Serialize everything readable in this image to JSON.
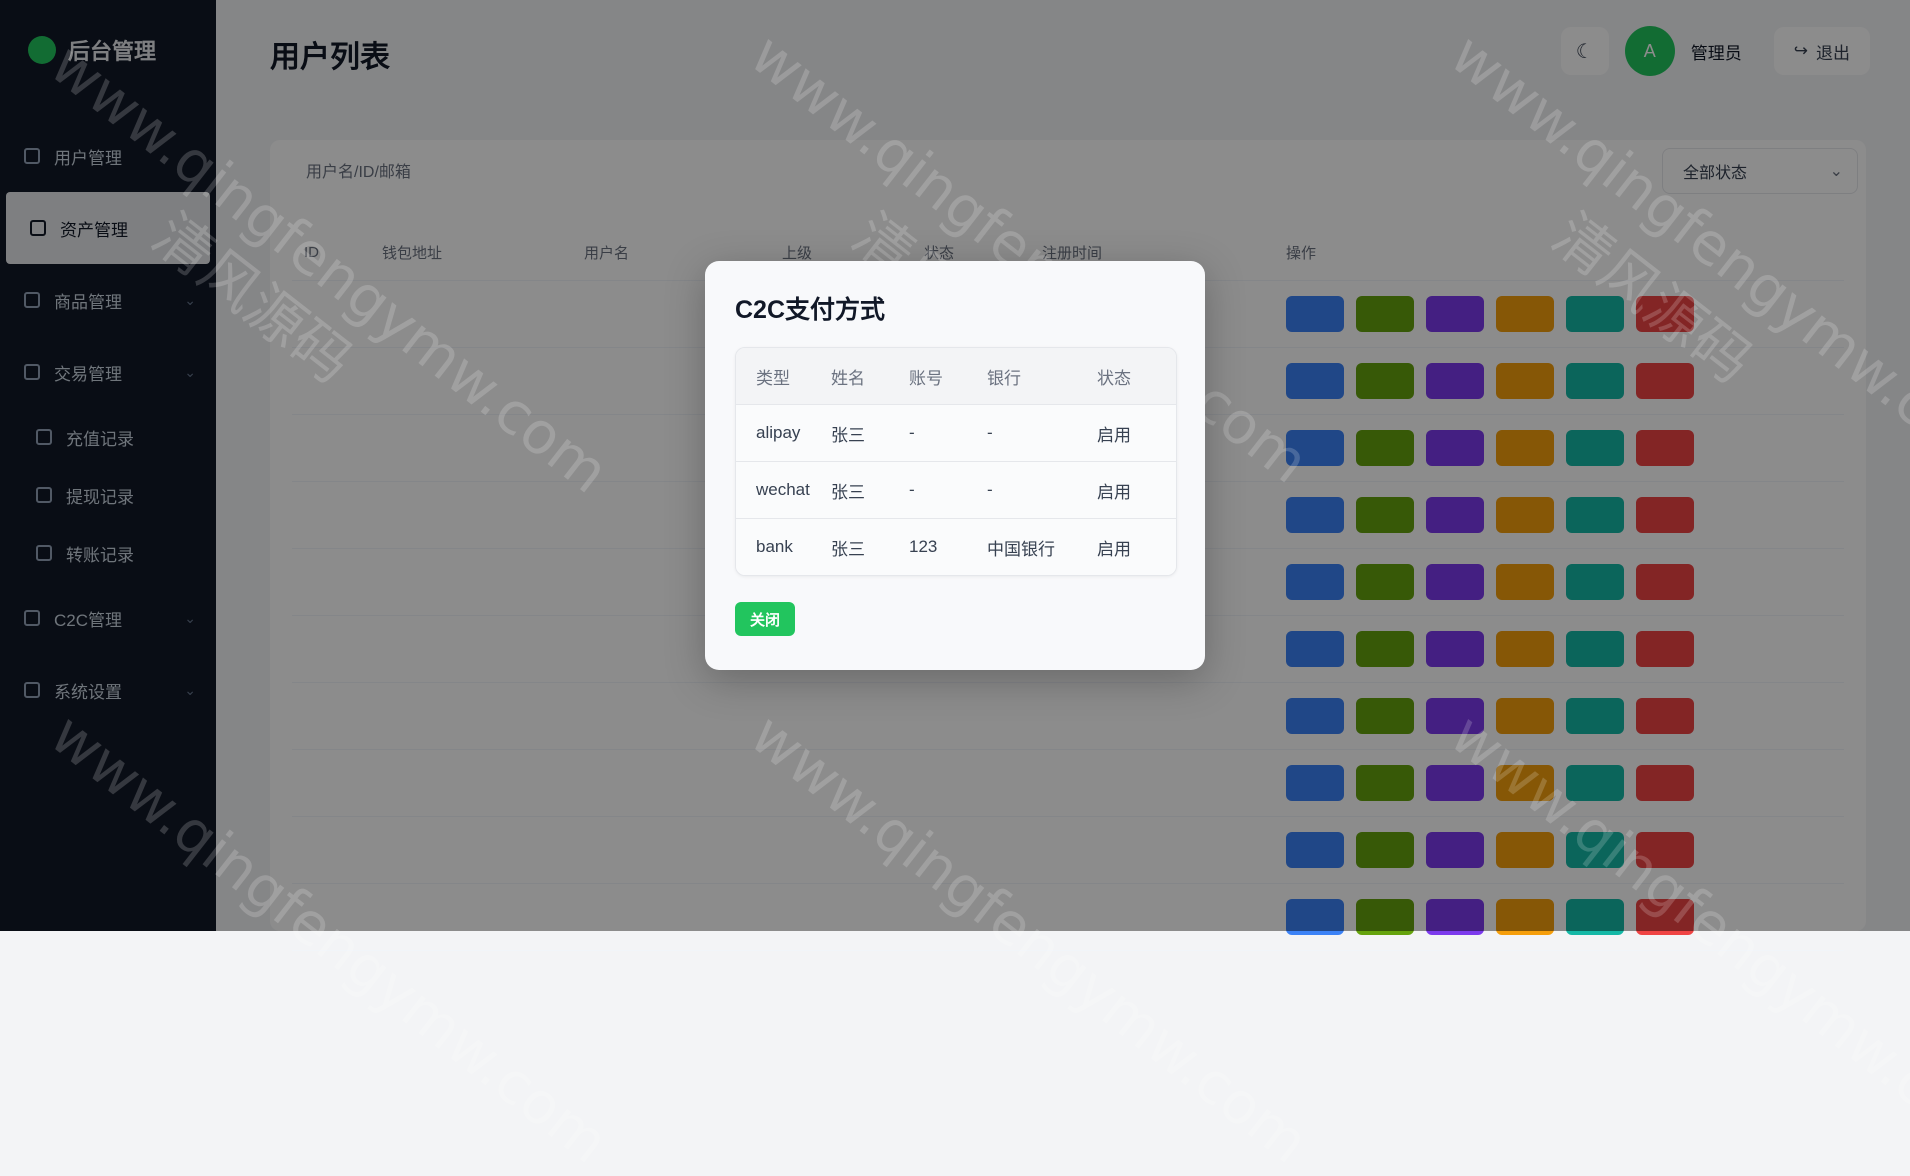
{
  "background": {
    "brand_name": "后台管理",
    "page_title": "用户列表",
    "user_name": "管理员",
    "avatar_text": "A",
    "logout_label": "退出",
    "sidebar_items": [
      {
        "label": "用户管理",
        "icon": "users-icon"
      },
      {
        "label": "资产管理",
        "icon": "wallet-icon"
      },
      {
        "label": "商品管理",
        "icon": "box-icon"
      },
      {
        "label": "交易管理",
        "icon": "exchange-icon"
      },
      {
        "label": "C2C管理",
        "icon": "c2c-icon"
      },
      {
        "label": "系统设置",
        "icon": "gear-icon"
      }
    ],
    "sidebar_subitems": [
      "充值记录",
      "提现记录",
      "转账记录"
    ],
    "search_hint": "用户名/ID/邮箱",
    "filter_label": "全部状态",
    "table_headers": [
      "ID",
      "钱包地址",
      "用户名",
      "上级",
      "状态",
      "注册时间",
      "操作"
    ],
    "table_rows": [
      {
        "id": "",
        "addr": "",
        "user": "",
        "parent": "",
        "status": "",
        "time": ""
      },
      {
        "id": "",
        "addr": "",
        "user": "",
        "parent": "",
        "status": "",
        "time": ""
      },
      {
        "id": "",
        "addr": "",
        "user": "",
        "parent": "",
        "status": "",
        "time": ""
      },
      {
        "id": "",
        "addr": "",
        "user": "",
        "parent": "",
        "status": "",
        "time": ""
      },
      {
        "id": "",
        "addr": "",
        "user": "",
        "parent": "",
        "status": "",
        "time": ""
      },
      {
        "id": "",
        "addr": "",
        "user": "",
        "parent": "",
        "status": "",
        "time": ""
      },
      {
        "id": "",
        "addr": "",
        "user": "",
        "parent": "",
        "status": "",
        "time": ""
      },
      {
        "id": "",
        "addr": "",
        "user": "",
        "parent": "",
        "status": "",
        "time": ""
      },
      {
        "id": "",
        "addr": "",
        "user": "",
        "parent": "",
        "status": "",
        "time": ""
      },
      {
        "id": "",
        "addr": "",
        "user": "",
        "parent": "",
        "status": "",
        "time": ""
      }
    ]
  },
  "modal": {
    "title": "C2C支付方式",
    "headers": {
      "type": "类型",
      "name": "姓名",
      "account": "账号",
      "bank": "银行",
      "status": "状态"
    },
    "rows": [
      {
        "type": "alipay",
        "name": "张三",
        "account": "-",
        "bank": "-",
        "status": "启用"
      },
      {
        "type": "wechat",
        "name": "张三",
        "account": "-",
        "bank": "-",
        "status": "启用"
      },
      {
        "type": "bank",
        "name": "张三",
        "account": "123",
        "bank": "中国银行",
        "status": "启用"
      }
    ],
    "close_label": "关闭"
  },
  "watermark": {
    "url": "www.qingfengymw.com",
    "cn": "清风源码"
  },
  "colors": {
    "accent": "#22c55e",
    "sidebar_bg": "#111827"
  }
}
